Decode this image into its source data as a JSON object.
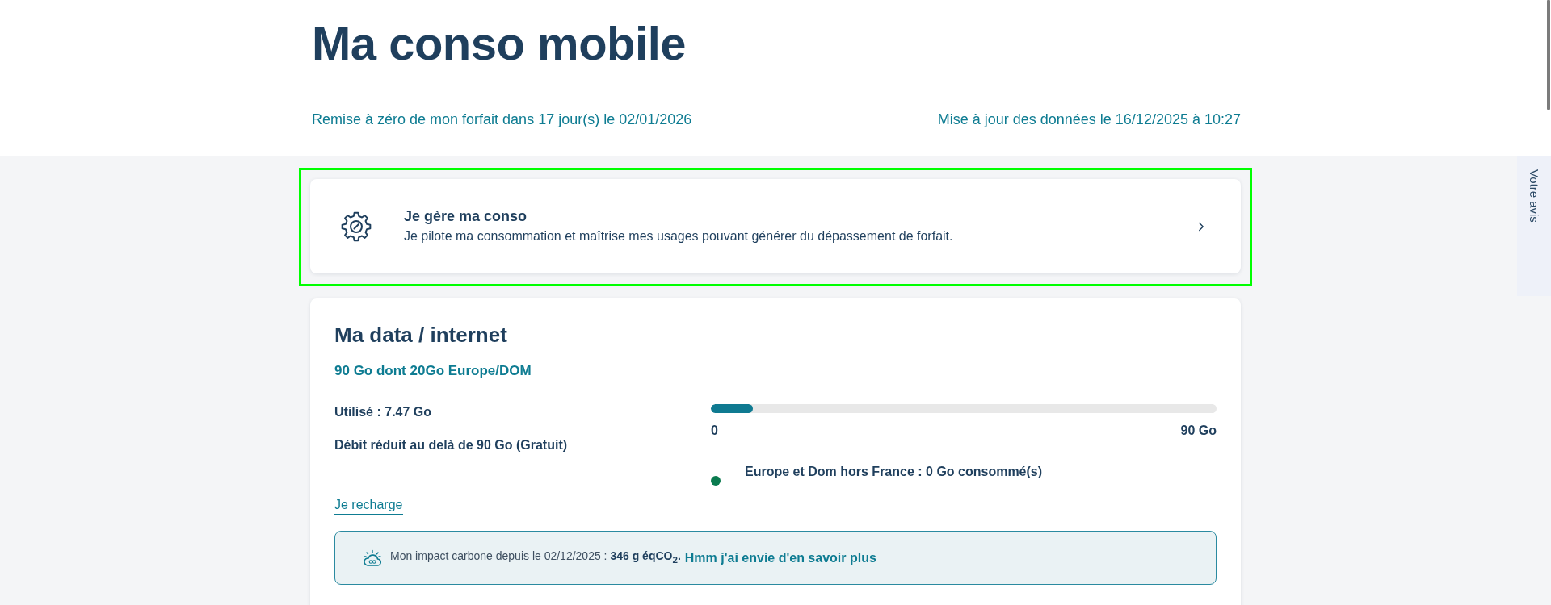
{
  "page": {
    "title": "Ma conso mobile",
    "reset_info": "Remise à zéro de mon forfait dans 17 jour(s) le 02/01/2026",
    "update_info": "Mise à jour des données le 16/12/2025 à 10:27"
  },
  "manage_card": {
    "title": "Je gère ma conso",
    "description": "Je pilote ma consommation et maîtrise mes usages pouvant générer du dépassement de forfait.",
    "highlighted": true
  },
  "data_card": {
    "title": "Ma data / internet",
    "plan": "90 Go dont 20Go Europe/DOM",
    "details": [
      "Utilisé : 7.47 Go",
      "Débit réduit au delà de 90 Go (Gratuit)"
    ],
    "usage_bar": {
      "level": 0.083,
      "min_label": "0",
      "max_label": "90 Go"
    },
    "legend": [
      {
        "label": "Europe et Dom hors France : 0 Go consommé(s)",
        "color": "#0a7b4f"
      }
    ],
    "recharge_link": "Je recharge",
    "carbon": {
      "text": "Mon impact carbone depuis le 02/12/2025 : **346 g éqCO$_{2}$.**",
      "link": "Hmm j'ai envie d'en savoir plus"
    }
  },
  "feedback_tab": {
    "label": "Votre avis"
  }
}
